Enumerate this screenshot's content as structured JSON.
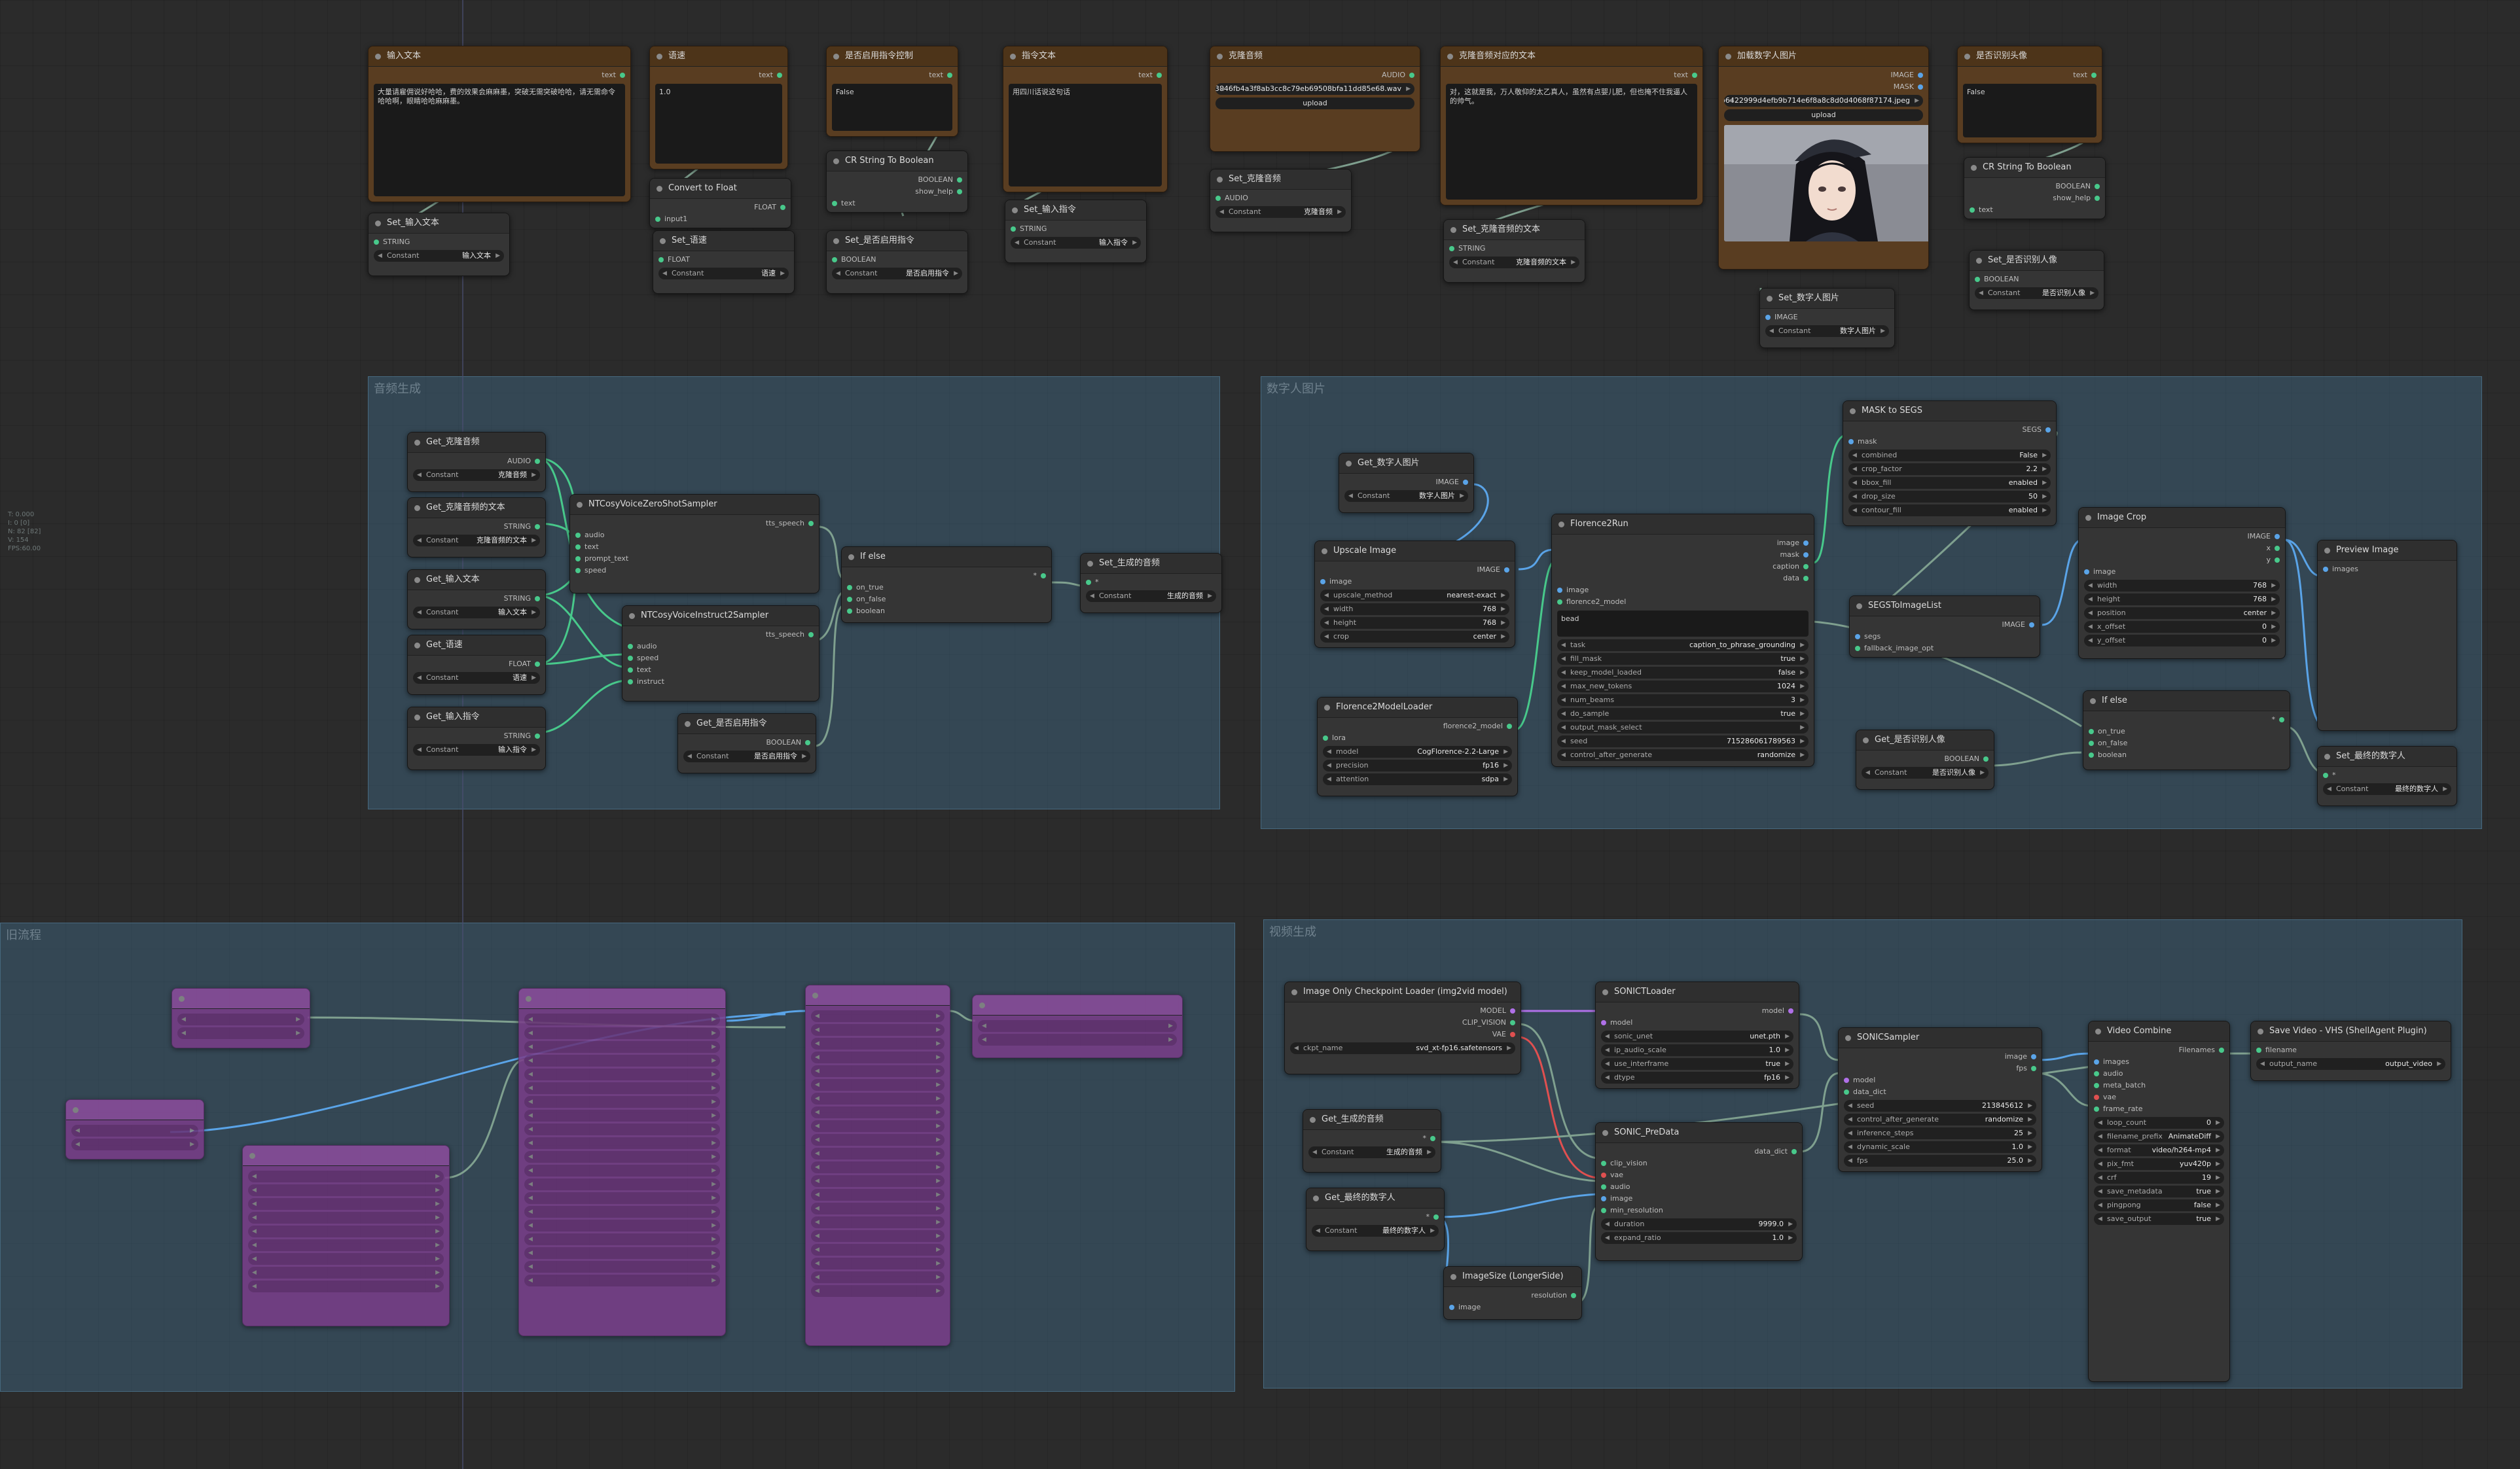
{
  "hud": [
    "T: 0.000",
    "I: 0 [0]",
    "N: 82 [82]",
    "V: 154",
    "FPS:60.00"
  ],
  "nodes": [
    {
      "id": "#122",
      "title": "输入文本",
      "style": "brown",
      "outputs": [
        "text"
      ],
      "textarea": "大量请雇佣说好哈哈，费的效果会麻麻墨，突破无需突破哈哈，请无需命令哈哈啊，眼睛哈哈麻麻墨。"
    },
    {
      "id": "#82",
      "title": "语速",
      "style": "brown",
      "outputs": [
        "text"
      ],
      "textarea": "1.0"
    },
    {
      "id": "#84",
      "title": "是否启用指令控制",
      "style": "brown",
      "outputs": [
        "text"
      ],
      "textarea": "False"
    },
    {
      "id": "#60",
      "title": "指令文本",
      "style": "brown",
      "outputs": [
        "text"
      ],
      "textarea": "用四川话说这句话"
    },
    {
      "id": "#6",
      "title": "克隆音频",
      "style": "brown",
      "outputs": [
        "AUDIO"
      ],
      "file": "8e5d43846fb4a3f8ab3cc8c79eb69508bfa11dd85e68.wav",
      "upload": "upload"
    },
    {
      "id": "#5",
      "title": "克隆音频对应的文本",
      "style": "brown",
      "outputs": [
        "text"
      ],
      "textarea": "对，这就是我，万人敬仰的太乙真人，虽然有点婴儿肥，但也掩不住我逼人的帅气。"
    },
    {
      "id": "#10",
      "title": "加载数字人图片",
      "style": "brown",
      "outputs": [
        "IMAGE",
        "MASK"
      ],
      "file": "76939eb83a2e2181f8bb6422999d4efb9b714e6f8a8c8d0d4068f87174.jpeg",
      "upload": "upload"
    },
    {
      "id": "#89",
      "title": "是否识别头像",
      "style": "brown",
      "outputs": [
        "text"
      ],
      "textarea": "False"
    },
    {
      "id": "",
      "title": "Set_输入文本",
      "inputs": [
        "STRING"
      ],
      "widgets": [
        [
          "Constant",
          "输入文本"
        ]
      ]
    },
    {
      "id": "#81",
      "title": "Convert to Float",
      "inputs": [
        "input1"
      ],
      "outputs": [
        "FLOAT"
      ]
    },
    {
      "id": "",
      "title": "Set_语速",
      "inputs": [
        "FLOAT"
      ],
      "widgets": [
        [
          "Constant",
          "语速"
        ]
      ]
    },
    {
      "id": "#87",
      "title": "CR String To Boolean",
      "inputs": [
        "text"
      ],
      "outputs": [
        "BOOLEAN",
        "show_help"
      ]
    },
    {
      "id": "",
      "title": "Set_是否启用指令",
      "inputs": [
        "BOOLEAN"
      ],
      "widgets": [
        [
          "Constant",
          "是否启用指令"
        ]
      ]
    },
    {
      "id": "",
      "title": "Set_输入指令",
      "inputs": [
        "STRING"
      ],
      "widgets": [
        [
          "Constant",
          "输入指令"
        ]
      ]
    },
    {
      "id": "",
      "title": "Set_克隆音频",
      "inputs": [
        "AUDIO"
      ],
      "widgets": [
        [
          "Constant",
          "克隆音频"
        ]
      ]
    },
    {
      "id": "",
      "title": "Set_克隆音频的文本",
      "inputs": [
        "STRING"
      ],
      "widgets": [
        [
          "Constant",
          "克隆音频的文本"
        ]
      ]
    },
    {
      "id": "",
      "title": "Set_数字人图片",
      "inputs": [
        "IMAGE"
      ],
      "widgets": [
        [
          "Constant",
          "数字人图片"
        ]
      ]
    },
    {
      "id": "#88",
      "title": "CR String To Boolean",
      "inputs": [
        "text"
      ],
      "outputs": [
        "BOOLEAN",
        "show_help"
      ]
    },
    {
      "id": "",
      "title": "Set_是否识别人像",
      "inputs": [
        "BOOLEAN"
      ],
      "widgets": [
        [
          "Constant",
          "是否识别人像"
        ]
      ]
    },
    {
      "id": "",
      "title": "Get_克隆音频",
      "outputs": [
        "AUDIO"
      ],
      "widgets": [
        [
          "Constant",
          "克隆音频"
        ]
      ]
    },
    {
      "id": "",
      "title": "Get_克隆音频的文本",
      "outputs": [
        "STRING"
      ],
      "widgets": [
        [
          "Constant",
          "克隆音频的文本"
        ]
      ]
    },
    {
      "id": "",
      "title": "Get_输入文本",
      "outputs": [
        "STRING"
      ],
      "widgets": [
        [
          "Constant",
          "输入文本"
        ]
      ]
    },
    {
      "id": "",
      "title": "Get_语速",
      "outputs": [
        "FLOAT"
      ],
      "widgets": [
        [
          "Constant",
          "语速"
        ]
      ]
    },
    {
      "id": "",
      "title": "Get_输入指令",
      "outputs": [
        "STRING"
      ],
      "widgets": [
        [
          "Constant",
          "输入指令"
        ]
      ]
    },
    {
      "id": "#12",
      "title": "NTCosyVoiceZeroShotSampler",
      "inputs": [
        "audio",
        "text",
        "prompt_text",
        "speed"
      ],
      "outputs": [
        "tts_speech"
      ]
    },
    {
      "id": "#62",
      "title": "NTCosyVoiceInstruct2Sampler",
      "inputs": [
        "audio",
        "speed",
        "text",
        "instruct"
      ],
      "outputs": [
        "tts_speech"
      ]
    },
    {
      "id": "",
      "title": "Get_是否启用指令",
      "outputs": [
        "BOOLEAN"
      ],
      "widgets": [
        [
          "Constant",
          "是否启用指令"
        ]
      ]
    },
    {
      "id": "#66",
      "title": "If else",
      "inputs": [
        "on_true",
        "on_false",
        "boolean"
      ],
      "outputs": [
        "*"
      ]
    },
    {
      "id": "",
      "title": "Set_生成的音频",
      "inputs": [
        "*"
      ],
      "widgets": [
        [
          "Constant",
          "生成的音频"
        ]
      ]
    },
    {
      "id": "",
      "title": "Get_数字人图片",
      "outputs": [
        "IMAGE"
      ],
      "widgets": [
        [
          "Constant",
          "数字人图片"
        ]
      ]
    },
    {
      "id": "#138",
      "title": "Upscale Image",
      "inputs": [
        "image"
      ],
      "outputs": [
        "IMAGE"
      ],
      "widgets": [
        [
          "upscale_method",
          "nearest-exact"
        ],
        [
          "width",
          "768"
        ],
        [
          "height",
          "768"
        ],
        [
          "crop",
          "center"
        ]
      ]
    },
    {
      "id": "#47",
      "title": "Florence2ModelLoader",
      "inputs": [
        "lora"
      ],
      "outputs": [
        "florence2_model"
      ],
      "widgets": [
        [
          "model",
          "CogFlorence-2.2-Large"
        ],
        [
          "precision",
          "fp16"
        ],
        [
          "attention",
          "sdpa"
        ]
      ]
    },
    {
      "id": "#48",
      "title": "Florence2Run",
      "inputs": [
        "image",
        "florence2_model"
      ],
      "outputs": [
        "image",
        "mask",
        "caption",
        "data"
      ],
      "textarea": "bead",
      "widgets": [
        [
          "task",
          "caption_to_phrase_grounding"
        ],
        [
          "fill_mask",
          "true"
        ],
        [
          "keep_model_loaded",
          "false"
        ],
        [
          "max_new_tokens",
          "1024"
        ],
        [
          "num_beams",
          "3"
        ],
        [
          "do_sample",
          "true"
        ],
        [
          "output_mask_select",
          ""
        ],
        [
          "seed",
          "715286061789563"
        ],
        [
          "control_after_generate",
          "randomize"
        ]
      ]
    },
    {
      "id": "#49",
      "title": "MASK to SEGS",
      "inputs": [
        "mask"
      ],
      "outputs": [
        "SEGS"
      ],
      "widgets": [
        [
          "combined",
          "False"
        ],
        [
          "crop_factor",
          "2.2"
        ],
        [
          "bbox_fill",
          "enabled"
        ],
        [
          "drop_size",
          "50"
        ],
        [
          "contour_fill",
          "enabled"
        ]
      ]
    },
    {
      "id": "#92",
      "title": "SEGSToImageList",
      "inputs": [
        "segs",
        "fallback_image_opt"
      ],
      "outputs": [
        "IMAGE"
      ]
    },
    {
      "id": "",
      "title": "Get_是否识别人像",
      "outputs": [
        "BOOLEAN"
      ],
      "widgets": [
        [
          "Constant",
          "是否识别人像"
        ]
      ]
    },
    {
      "id": "#52",
      "title": "Image Crop",
      "inputs": [
        "image"
      ],
      "outputs": [
        "IMAGE",
        "x",
        "y"
      ],
      "widgets": [
        [
          "width",
          "768"
        ],
        [
          "height",
          "768"
        ],
        [
          "position",
          "center"
        ],
        [
          "x_offset",
          "0"
        ],
        [
          "y_offset",
          "0"
        ]
      ]
    },
    {
      "id": "#130",
      "title": "If else",
      "inputs": [
        "on_true",
        "on_false",
        "boolean"
      ],
      "outputs": [
        "*"
      ]
    },
    {
      "id": "#137",
      "title": "Preview Image",
      "inputs": [
        "images"
      ]
    },
    {
      "id": "",
      "title": "Set_最终的数字人",
      "inputs": [
        "*"
      ],
      "widgets": [
        [
          "Constant",
          "最终的数字人"
        ]
      ]
    },
    {
      "id": "#148",
      "title": "Image Only Checkpoint Loader (img2vid model)",
      "outputs": [
        "MODEL",
        "CLIP_VISION",
        "VAE"
      ],
      "widgets": [
        [
          "ckpt_name",
          "svd_xt-fp16.safetensors"
        ]
      ]
    },
    {
      "id": "#143",
      "title": "SONICTLoader",
      "inputs": [
        "model"
      ],
      "outputs": [
        "model"
      ],
      "widgets": [
        [
          "sonic_unet",
          "unet.pth"
        ],
        [
          "ip_audio_scale",
          "1.0"
        ],
        [
          "use_interframe",
          "true"
        ],
        [
          "dtype",
          "fp16"
        ]
      ]
    },
    {
      "id": "",
      "title": "Get_生成的音频",
      "outputs": [
        "*"
      ],
      "widgets": [
        [
          "Constant",
          "生成的音频"
        ]
      ]
    },
    {
      "id": "#147",
      "title": "SONIC_PreData",
      "inputs": [
        "clip_vision",
        "vae",
        "audio",
        "image",
        "min_resolution"
      ],
      "outputs": [
        "data_dict"
      ],
      "widgets": [
        [
          "duration",
          "9999.0"
        ],
        [
          "expand_ratio",
          "1.0"
        ]
      ]
    },
    {
      "id": "",
      "title": "Get_最终的数字人",
      "outputs": [
        "*"
      ],
      "widgets": [
        [
          "Constant",
          "最终的数字人"
        ]
      ]
    },
    {
      "id": "#153",
      "title": "ImageSize (LongerSide)",
      "inputs": [
        "image"
      ],
      "outputs": [
        "resolution"
      ]
    },
    {
      "id": "#156",
      "title": "SONICSampler",
      "inputs": [
        "model",
        "data_dict"
      ],
      "outputs": [
        "image",
        "fps"
      ],
      "widgets": [
        [
          "seed",
          "213845612"
        ],
        [
          "control_after_generate",
          "randomize"
        ],
        [
          "inference_steps",
          "25"
        ],
        [
          "dynamic_scale",
          "1.0"
        ],
        [
          "fps",
          "25.0"
        ]
      ]
    },
    {
      "id": "#155",
      "title": "Video Combine",
      "inputs": [
        "images",
        "audio",
        "meta_batch",
        "vae",
        "frame_rate"
      ],
      "outputs": [
        "Filenames"
      ],
      "widgets": [
        [
          "loop_count",
          "0"
        ],
        [
          "filename_prefix",
          "AnimateDiff"
        ],
        [
          "format",
          "video/h264-mp4"
        ],
        [
          "pix_fmt",
          "yuv420p"
        ],
        [
          "crf",
          "19"
        ],
        [
          "save_metadata",
          "true"
        ],
        [
          "pingpong",
          "false"
        ],
        [
          "save_output",
          "true"
        ]
      ]
    },
    {
      "id": "#157",
      "title": "Save Video - VHS (ShellAgent Plugin)",
      "inputs": [
        "filename"
      ],
      "widgets": [
        [
          "output_name",
          "output_video"
        ]
      ]
    }
  ]
}
